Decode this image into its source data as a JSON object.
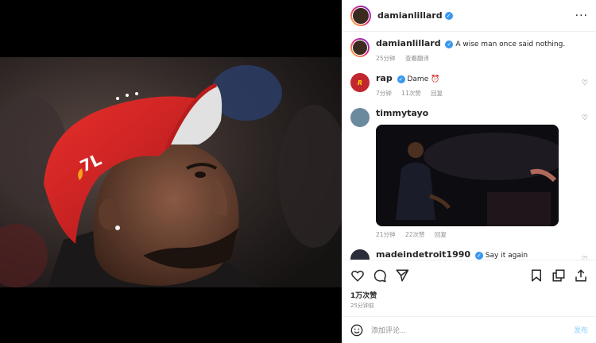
{
  "header": {
    "username": "damianlillard",
    "verified_icon": "verified-badge-icon",
    "more_icon": "more-icon"
  },
  "caption": {
    "username": "damianlillard",
    "text": "A wise man once said nothing.",
    "time": "25分钟",
    "translate": "查看翻译"
  },
  "photo": {
    "cap_text": "7L"
  },
  "comments": [
    {
      "username": "rap",
      "text": "Dame ⏰",
      "time": "7分钟",
      "likes": "11次赞",
      "reply": "回复"
    },
    {
      "username": "timmytayo",
      "text": "",
      "time": "21分钟",
      "likes": "22次赞",
      "reply": "回复"
    },
    {
      "username": "madeindetroit1990",
      "text": "Say it again"
    }
  ],
  "actions": {
    "like_icon": "heart-icon",
    "comment_icon": "comment-icon",
    "share_icon": "send-icon",
    "save_icon": "bookmark-icon",
    "other_icon": "copy-icon"
  },
  "stats": {
    "likes": "1万次赞",
    "time": "25分钟前"
  },
  "composer": {
    "emoji_icon": "emoji-icon",
    "placeholder": "添加评论...",
    "post_label": "发布"
  },
  "colors": {
    "verified": "#3897f0",
    "cap_red": "#d6201f",
    "post_disabled": "#b2dffc"
  }
}
